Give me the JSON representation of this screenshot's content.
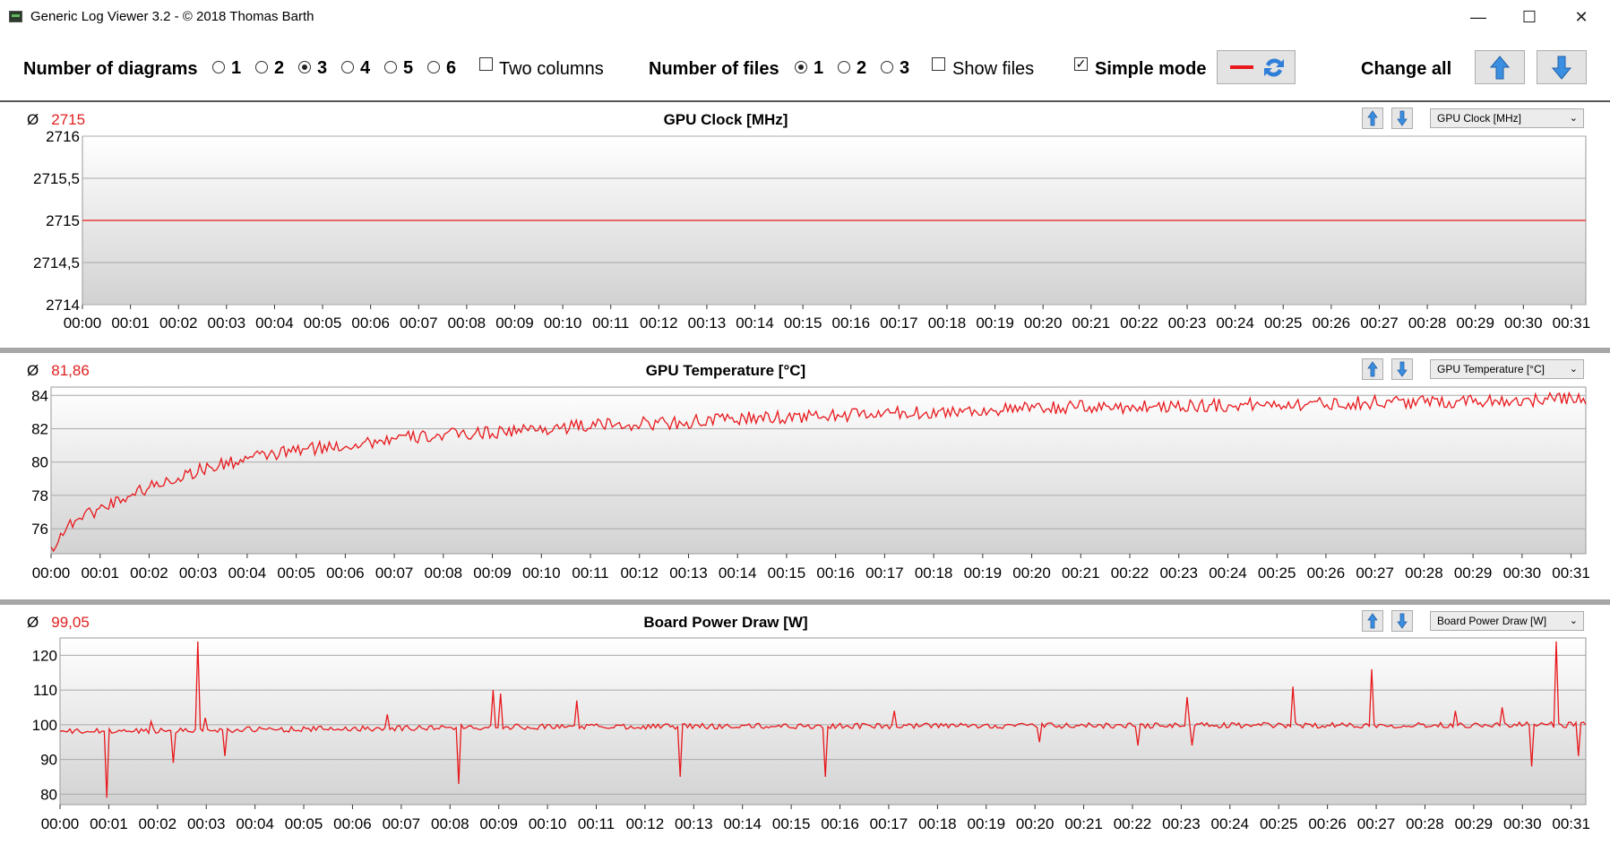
{
  "window": {
    "title": "Generic Log Viewer 3.2 - © 2018 Thomas Barth",
    "minimize_glyph": "—",
    "maximize_glyph": "☐",
    "close_glyph": "✕"
  },
  "toolbar": {
    "num_diagrams_label": "Number of diagrams",
    "diagram_options": [
      "1",
      "2",
      "3",
      "4",
      "5",
      "6"
    ],
    "diagram_selected": "3",
    "two_columns_label": "Two columns",
    "two_columns_checked": false,
    "num_files_label": "Number of files",
    "file_options": [
      "1",
      "2",
      "3"
    ],
    "file_selected": "1",
    "show_files_label": "Show files",
    "show_files_checked": false,
    "simple_mode_label": "Simple mode",
    "simple_mode_checked": true,
    "change_all_label": "Change all"
  },
  "colors": {
    "series": "#e8181c",
    "avg": "#e02020",
    "grid": "#a8a8a8",
    "plot_top": "#ffffff",
    "plot_bottom": "#d2d2d2",
    "arrow_blue": "#3b8fe0"
  },
  "panels": [
    {
      "avg_symbol": "Ø",
      "avg_value": "2715",
      "title": "GPU Clock [MHz]",
      "dropdown": "GPU Clock [MHz]",
      "ytick_labels": [
        "2716",
        "2715,5",
        "2715",
        "2714,5",
        "2714"
      ]
    },
    {
      "avg_symbol": "Ø",
      "avg_value": "81,86",
      "title": "GPU Temperature [°C]",
      "dropdown": "GPU Temperature [°C]",
      "ytick_labels": [
        "84",
        "82",
        "80",
        "78",
        "76"
      ]
    },
    {
      "avg_symbol": "Ø",
      "avg_value": "99,05",
      "title": "Board Power Draw [W]",
      "dropdown": "Board Power Draw [W]",
      "ytick_labels": [
        "120",
        "110",
        "100",
        "90",
        "80"
      ]
    }
  ],
  "chart_data": [
    {
      "type": "line",
      "title": "GPU Clock [MHz]",
      "ylim": [
        2714,
        2716
      ],
      "yticks": [
        2716,
        2715.5,
        2715,
        2714.5,
        2714
      ],
      "x_ticks": [
        "00:00",
        "00:01",
        "00:02",
        "00:03",
        "00:04",
        "00:05",
        "00:06",
        "00:07",
        "00:08",
        "00:09",
        "00:10",
        "00:11",
        "00:12",
        "00:13",
        "00:14",
        "00:15",
        "00:16",
        "00:17",
        "00:18",
        "00:19",
        "00:20",
        "00:21",
        "00:22",
        "00:23",
        "00:24",
        "00:25",
        "00:26",
        "00:27",
        "00:28",
        "00:29",
        "00:30",
        "00:31"
      ],
      "x_minutes": [
        0,
        31.3
      ],
      "series": [
        {
          "values_x": [
            0,
            31.3
          ],
          "values_y": [
            2715,
            2715
          ]
        }
      ],
      "grid": true
    },
    {
      "type": "line",
      "title": "GPU Temperature [°C]",
      "ylim": [
        74.5,
        84.5
      ],
      "yticks": [
        84,
        82,
        80,
        78,
        76
      ],
      "x_ticks": [
        "00:00",
        "00:01",
        "00:02",
        "00:03",
        "00:04",
        "00:05",
        "00:06",
        "00:07",
        "00:08",
        "00:09",
        "00:10",
        "00:11",
        "00:12",
        "00:13",
        "00:14",
        "00:15",
        "00:16",
        "00:17",
        "00:18",
        "00:19",
        "00:20",
        "00:21",
        "00:22",
        "00:23",
        "00:24",
        "00:25",
        "00:26",
        "00:27",
        "00:28",
        "00:29",
        "00:30",
        "00:31"
      ],
      "x_minutes": [
        0,
        31.3
      ],
      "series": [
        {
          "values_x": [
            0,
            0.25,
            0.5,
            1,
            1.5,
            2,
            2.5,
            3,
            4,
            5,
            6,
            7,
            8,
            9,
            10,
            11,
            12,
            13,
            14,
            15,
            16,
            17,
            18,
            19,
            20,
            21,
            22,
            23,
            24,
            25,
            26,
            27,
            28,
            29,
            30,
            31,
            31.3
          ],
          "values_y": [
            74.8,
            75.8,
            76.6,
            77.2,
            77.9,
            78.5,
            79.0,
            79.5,
            80.2,
            80.7,
            81.0,
            81.4,
            81.6,
            81.8,
            82.0,
            82.2,
            82.3,
            82.4,
            82.6,
            82.7,
            82.8,
            82.9,
            83.0,
            83.1,
            83.2,
            83.3,
            83.3,
            83.4,
            83.4,
            83.5,
            83.5,
            83.6,
            83.6,
            83.7,
            83.7,
            83.8,
            83.8
          ],
          "noise": 0.4
        }
      ],
      "grid": true
    },
    {
      "type": "line",
      "title": "Board Power Draw [W]",
      "ylim": [
        77,
        125
      ],
      "yticks": [
        120,
        110,
        100,
        90,
        80
      ],
      "x_ticks": [
        "00:00",
        "00:01",
        "00:02",
        "00:03",
        "00:04",
        "00:05",
        "00:06",
        "00:07",
        "00:08",
        "00:09",
        "00:10",
        "00:11",
        "00:12",
        "00:13",
        "00:14",
        "00:15",
        "00:16",
        "00:17",
        "00:18",
        "00:19",
        "00:20",
        "00:21",
        "00:22",
        "00:23",
        "00:24",
        "00:25",
        "00:26",
        "00:27",
        "00:28",
        "00:29",
        "00:30",
        "00:31"
      ],
      "x_minutes": [
        0,
        31.3
      ],
      "series": [
        {
          "baseline_x": [
            0,
            10,
            31.3
          ],
          "baseline_y": [
            98,
            99.5,
            100
          ],
          "spikes": [
            {
              "x": 0.98,
              "y": 79
            },
            {
              "x": 1.85,
              "y": 101
            },
            {
              "x": 2.3,
              "y": 89
            },
            {
              "x": 2.85,
              "y": 124
            },
            {
              "x": 3.0,
              "y": 102
            },
            {
              "x": 3.4,
              "y": 91
            },
            {
              "x": 6.7,
              "y": 103
            },
            {
              "x": 8.2,
              "y": 83
            },
            {
              "x": 8.9,
              "y": 110
            },
            {
              "x": 9.05,
              "y": 109
            },
            {
              "x": 10.6,
              "y": 107
            },
            {
              "x": 12.7,
              "y": 85
            },
            {
              "x": 15.7,
              "y": 85
            },
            {
              "x": 17.1,
              "y": 104
            },
            {
              "x": 20.1,
              "y": 95
            },
            {
              "x": 22.1,
              "y": 94
            },
            {
              "x": 23.1,
              "y": 108
            },
            {
              "x": 23.2,
              "y": 94
            },
            {
              "x": 25.3,
              "y": 111
            },
            {
              "x": 26.9,
              "y": 116
            },
            {
              "x": 28.6,
              "y": 104
            },
            {
              "x": 29.6,
              "y": 105
            },
            {
              "x": 30.2,
              "y": 88
            },
            {
              "x": 30.7,
              "y": 124
            },
            {
              "x": 31.15,
              "y": 91
            }
          ],
          "noise": 0.8
        }
      ],
      "grid": true
    }
  ]
}
